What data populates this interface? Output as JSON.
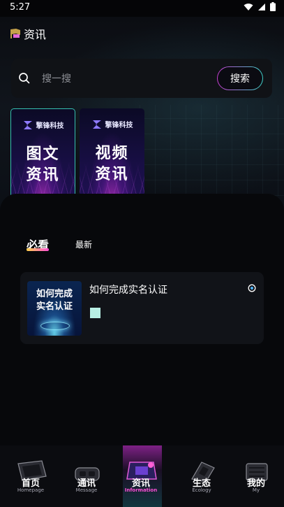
{
  "status_bar": {
    "time": "5:27"
  },
  "header": {
    "title": "资讯"
  },
  "search": {
    "placeholder": "搜一搜",
    "button_label": "搜索"
  },
  "categories": [
    {
      "brand": "擎锋科技",
      "title": "图文\n资讯",
      "active": true
    },
    {
      "brand": "擎锋科技",
      "title": "视频\n资讯",
      "active": false
    }
  ],
  "feed_tabs": [
    {
      "label": "必看",
      "active": true
    },
    {
      "label": "最新",
      "active": false
    }
  ],
  "articles": [
    {
      "title": "如何完成实名认证",
      "thumb_text": "如何完成\n实名认证"
    }
  ],
  "bottom_nav": [
    {
      "label": "首页",
      "sub": "Homepage",
      "icon": "home-icon"
    },
    {
      "label": "通讯",
      "sub": "Message",
      "icon": "vr-headset-icon"
    },
    {
      "label": "资讯",
      "sub": "Information",
      "icon": "info-icon",
      "active": true
    },
    {
      "label": "生态",
      "sub": "Ecology",
      "icon": "ecology-icon"
    },
    {
      "label": "我的",
      "sub": "My",
      "icon": "profile-icon"
    }
  ],
  "colors": {
    "accent_pink": "#ff4fd8",
    "accent_teal": "#3dd3c8",
    "tab_underline_start": "#ffd24a",
    "active_nav_text": "#ff4fd8"
  }
}
